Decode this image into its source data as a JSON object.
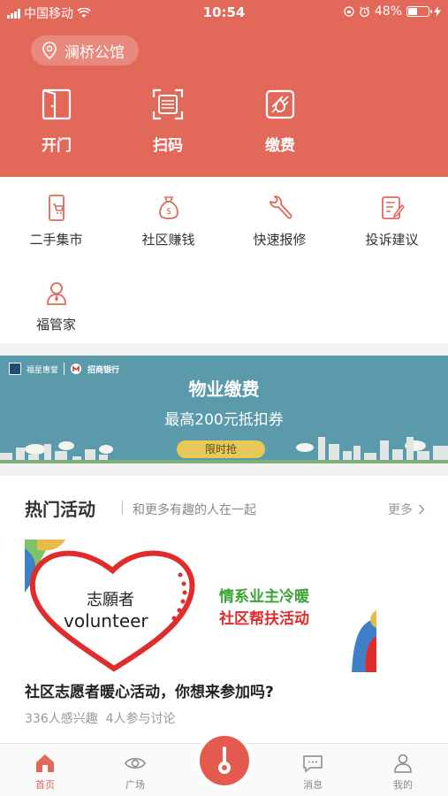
{
  "status": {
    "carrier": "中国移动",
    "time": "10:54",
    "battery": "48%",
    "battery_level": 0.48
  },
  "location": {
    "name": "澜桥公馆"
  },
  "quick_actions": [
    {
      "label": "开门",
      "icon": "door-icon"
    },
    {
      "label": "扫码",
      "icon": "scan-icon"
    },
    {
      "label": "缴费",
      "icon": "payment-icon"
    }
  ],
  "services": [
    {
      "label": "二手集市",
      "icon": "phone-cart-icon"
    },
    {
      "label": "社区赚钱",
      "icon": "money-bag-icon"
    },
    {
      "label": "快速报修",
      "icon": "wrench-icon"
    },
    {
      "label": "投诉建议",
      "icon": "edit-note-icon"
    },
    {
      "label": "福管家",
      "icon": "butler-icon"
    }
  ],
  "banner": {
    "brand1": "福星惠誉",
    "brand2": "招商银行",
    "title": "物业缴费",
    "subtitle": "最高200元抵扣券",
    "button": "限时抢"
  },
  "activities": {
    "title": "热门活动",
    "subtitle": "和更多有趣的人在一起",
    "more": "更多",
    "image_text": {
      "heart_line1": "志願者",
      "heart_line2": "volunteer",
      "line1": "情系业主冷暖",
      "line2": "社区帮扶活动"
    },
    "item_title": "社区志愿者暖心活动，你想来参加吗?",
    "item_meta": "336人感兴趣  4人参与讨论"
  },
  "tabs": [
    {
      "label": "首页",
      "icon": "home-icon",
      "active": true
    },
    {
      "label": "广场",
      "icon": "eye-icon",
      "active": false
    },
    {
      "label": "消息",
      "icon": "chat-icon",
      "active": false
    },
    {
      "label": "我的",
      "icon": "user-icon",
      "active": false
    }
  ],
  "colors": {
    "primary": "#e2685a",
    "banner": "#5a9aab",
    "button": "#e7c95a"
  }
}
